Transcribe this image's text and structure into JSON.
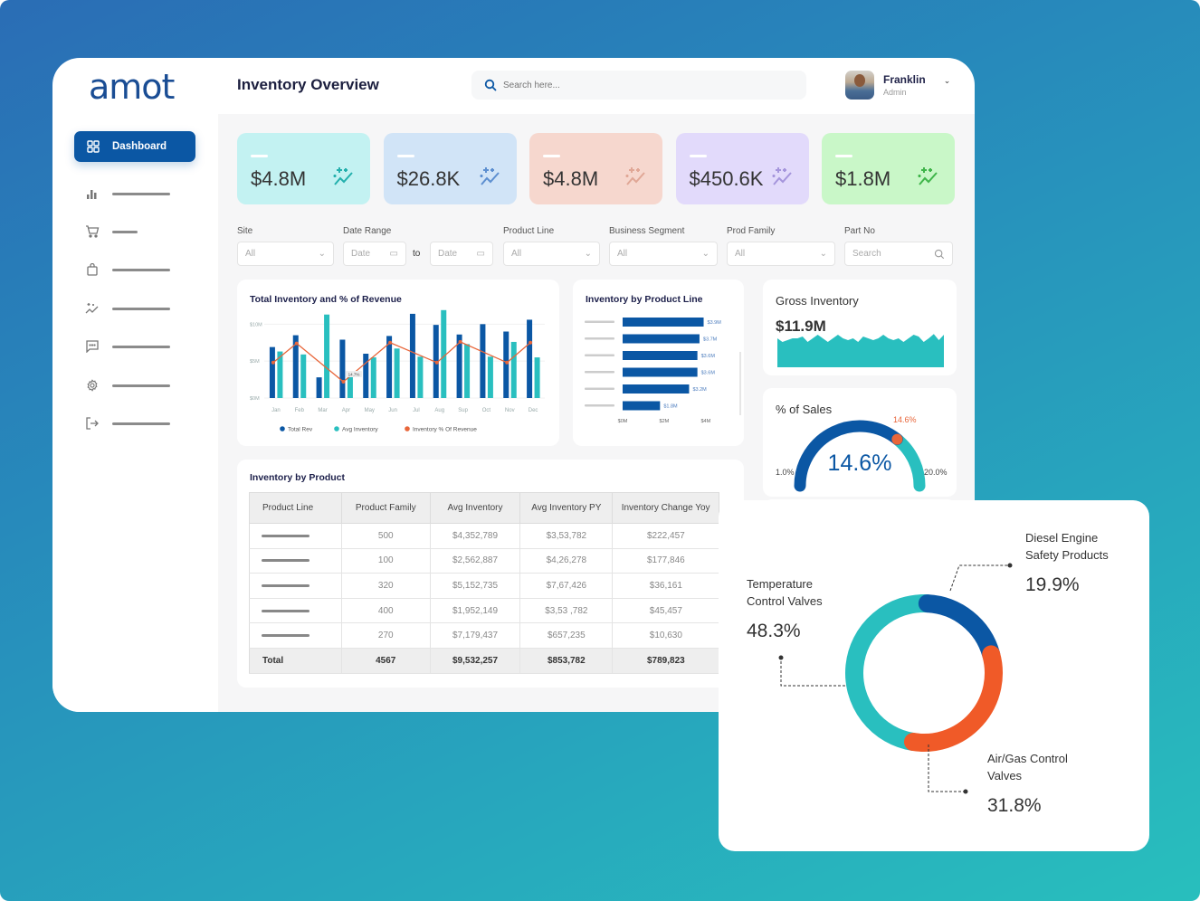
{
  "app": {
    "logo": "amot",
    "title": "Inventory Overview"
  },
  "header": {
    "search_placeholder": "Search here...",
    "user": {
      "name": "Franklin",
      "role": "Admin"
    }
  },
  "sidebar": {
    "active": {
      "label": "Dashboard",
      "icon": "grid-icon"
    },
    "items": [
      {
        "icon": "bar-chart-icon"
      },
      {
        "icon": "cart-icon"
      },
      {
        "icon": "shopping-bag-icon"
      },
      {
        "icon": "sparkle-trend-icon"
      },
      {
        "icon": "message-icon"
      },
      {
        "icon": "gear-icon"
      },
      {
        "icon": "logout-icon"
      }
    ]
  },
  "kpis": [
    {
      "value": "$4.8M",
      "bg": "#c3f2f2",
      "icon_color": "#23b0ad"
    },
    {
      "value": "$26.8K",
      "bg": "#d1e4f7",
      "icon_color": "#5d8fd0"
    },
    {
      "value": "$4.8M",
      "bg": "#f6d7ce",
      "icon_color": "#e0a796"
    },
    {
      "value": "$450.6K",
      "bg": "#e2dafb",
      "icon_color": "#a595dc"
    },
    {
      "value": "$1.8M",
      "bg": "#c9f7c8",
      "icon_color": "#3fb54a"
    }
  ],
  "filters": {
    "site": {
      "label": "Site",
      "value": "All"
    },
    "date_range": {
      "label": "Date Range",
      "from": "Date",
      "to_label": "to",
      "to": "Date"
    },
    "product_line": {
      "label": "Product Line",
      "value": "All"
    },
    "business_segment": {
      "label": "Business Segment",
      "value": "All"
    },
    "prod_family": {
      "label": "Prod Family",
      "value": "All"
    },
    "part_no": {
      "label": "Part No",
      "placeholder": "Search"
    }
  },
  "gross_inventory": {
    "title": "Gross Inventory",
    "value": "$11.9M"
  },
  "pct_sales": {
    "title": "% of Sales",
    "value": "14.6%",
    "marker_label": "14.6%",
    "min_label": "1.0%",
    "max_label": "20.0%",
    "min": 1.0,
    "max": 20.0,
    "current": 14.6
  },
  "table": {
    "title": "Inventory by Product",
    "columns": [
      "Product Line",
      "Product Family",
      "Avg Inventory",
      "Avg Inventory PY",
      "Inventory Change Yoy"
    ],
    "rows": [
      [
        "",
        "500",
        "$4,352,789",
        "$3,53,782",
        "$222,457"
      ],
      [
        "",
        "100",
        "$2,562,887",
        "$4,26,278",
        "$177,846"
      ],
      [
        "",
        "320",
        "$5,152,735",
        "$7,67,426",
        "$36,161"
      ],
      [
        "",
        "400",
        "$1,952,149",
        "$3,53 ,782",
        "$45,457"
      ],
      [
        "",
        "270",
        "$7,179,437",
        "$657,235",
        "$10,630"
      ]
    ],
    "total": [
      "Total",
      "4567",
      "$9,532,257",
      "$853,782",
      "$789,823"
    ]
  },
  "chart_data": [
    {
      "type": "bar",
      "title": "Total Inventory and % of Revenue",
      "categories": [
        "Jan",
        "Feb",
        "Mar",
        "Apr",
        "May",
        "Jun",
        "Jul",
        "Aug",
        "Sup",
        "Oct",
        "Nov",
        "Dec"
      ],
      "yticks": [
        "$0M",
        "$5M",
        "$10M"
      ],
      "ylim": [
        0,
        12
      ],
      "series": [
        {
          "name": "Total Rev",
          "color": "#0b57a4",
          "values": [
            6.9,
            8.5,
            2.8,
            7.9,
            6.0,
            8.4,
            11.4,
            9.9,
            8.6,
            10.0,
            9.0,
            10.6
          ]
        },
        {
          "name": "Avg Inventory",
          "color": "#29bfbf",
          "values": [
            6.3,
            5.9,
            11.3,
            3.2,
            5.5,
            6.7,
            5.6,
            11.9,
            7.3,
            5.6,
            7.6,
            5.5
          ]
        },
        {
          "name": "Inventory % Of Revenue",
          "type": "line",
          "color": "#e8663a",
          "values": [
            4.8,
            7.4,
            null,
            2.2,
            null,
            7.5,
            null,
            4.8,
            7.6,
            null,
            4.8,
            7.5
          ]
        }
      ],
      "annotation": "14.7%",
      "legend": "bottom"
    },
    {
      "type": "bar",
      "orientation": "horizontal",
      "title": "Inventory by Product Line",
      "categories": [
        "",
        "",
        "",
        "",
        "",
        ""
      ],
      "values": [
        3.9,
        3.7,
        3.6,
        3.6,
        3.2,
        1.8
      ],
      "labels": [
        "$3.9M",
        "$3.7M",
        "$3.6M",
        "$3.6M",
        "$3.2M",
        "$1.8M"
      ],
      "xticks": [
        "$0M",
        "$2M",
        "$4M"
      ],
      "xlim": [
        0,
        4.4
      ]
    },
    {
      "type": "area",
      "title": "Gross Inventory",
      "values": [
        8,
        7,
        7.5,
        8,
        8,
        8.5,
        7,
        8,
        9,
        8,
        7,
        8,
        9,
        8,
        7.5,
        8,
        7,
        8.5,
        8,
        7.5,
        8,
        9,
        8,
        7.5,
        8,
        7,
        8,
        9,
        8.5,
        7,
        8,
        9.2,
        7.5,
        9
      ]
    },
    {
      "type": "pie",
      "title": "Inventory Share",
      "slices": [
        {
          "label": "Temperature Control Valves",
          "value": 48.3,
          "display": "48.3%",
          "color": "#29bfbf"
        },
        {
          "label": "Diesel Engine Safety Products",
          "value": 19.9,
          "display": "19.9%",
          "color": "#0b57a4"
        },
        {
          "label": "Air/Gas Control Valves",
          "value": 31.8,
          "display": "31.8%",
          "color": "#f05a28"
        }
      ]
    }
  ]
}
